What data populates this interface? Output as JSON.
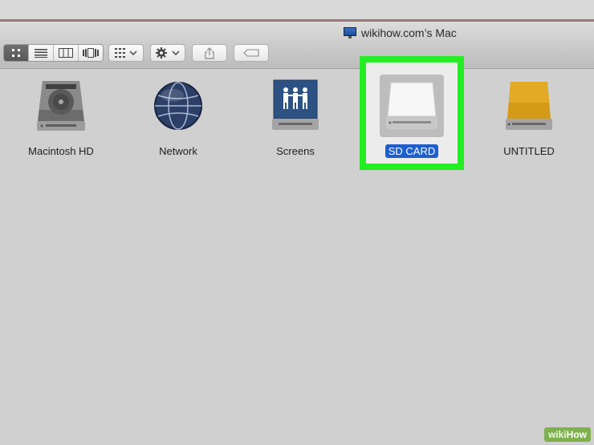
{
  "window": {
    "title": "wikihow.com’s Mac"
  },
  "toolbar": {
    "view_modes": [
      "icon-view-icon",
      "list-view-icon",
      "column-view-icon",
      "coverflow-view-icon"
    ],
    "arrange_icon": "arrange-icon",
    "action_icon": "gear-icon",
    "share_icon": "share-icon",
    "tag_icon": "tag-icon"
  },
  "devices": [
    {
      "label": "Macintosh HD",
      "icon": "hard-drive-icon"
    },
    {
      "label": "Network",
      "icon": "network-globe-icon"
    },
    {
      "label": "Screens",
      "icon": "shared-screens-icon"
    },
    {
      "label": "SD CARD",
      "icon": "sd-card-drive-icon",
      "selected": true
    },
    {
      "label": "UNTITLED",
      "icon": "external-drive-icon"
    }
  ],
  "colors": {
    "selection": "#1d5fd2",
    "highlight_frame": "#22ee22"
  },
  "watermark": {
    "part1": "wiki",
    "part2": "How"
  }
}
